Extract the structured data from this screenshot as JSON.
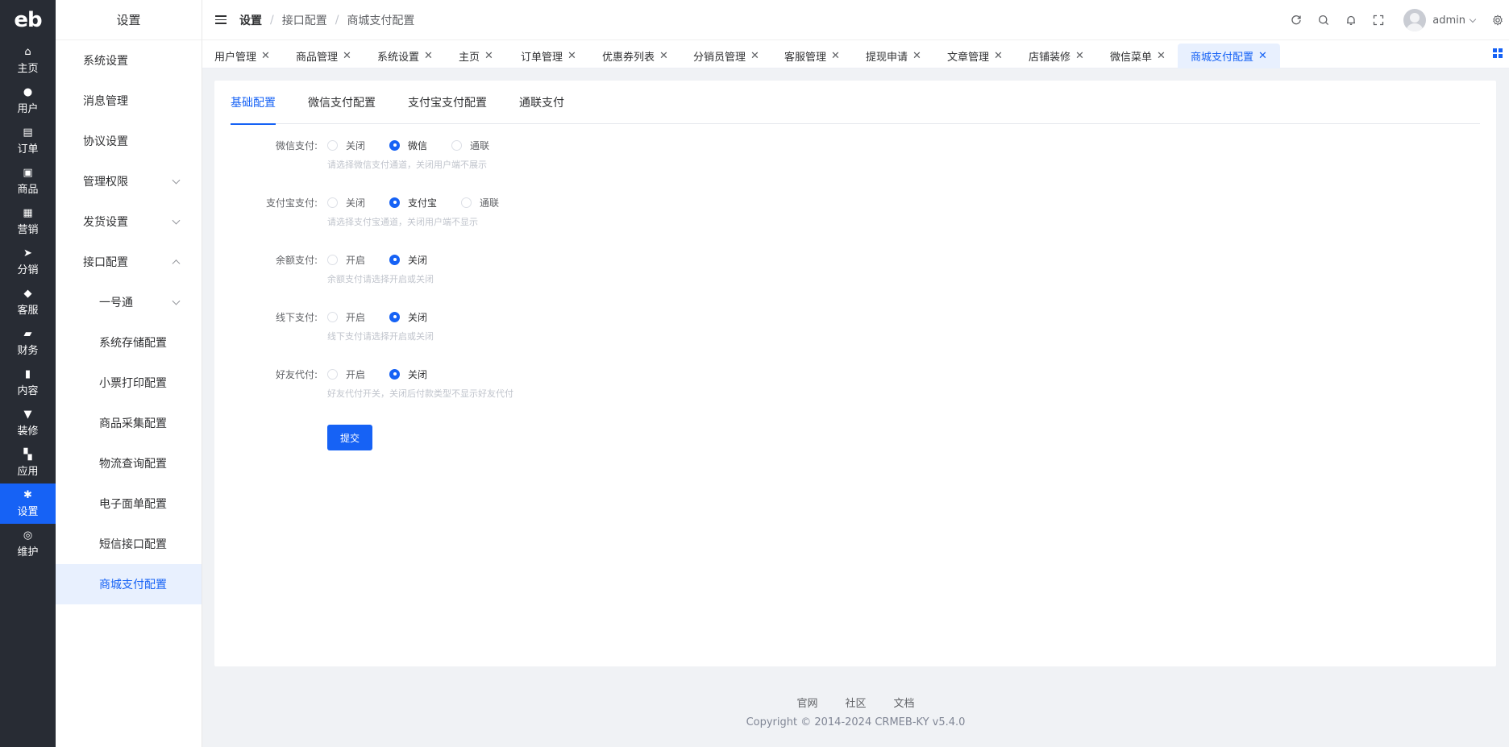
{
  "rail": {
    "logo": "eb",
    "items": [
      {
        "label": "主页",
        "icon": "home-icon",
        "glyph": "⌂"
      },
      {
        "label": "用户",
        "icon": "user-icon",
        "glyph": "●"
      },
      {
        "label": "订单",
        "icon": "order-icon",
        "glyph": "▤"
      },
      {
        "label": "商品",
        "icon": "product-icon",
        "glyph": "▣"
      },
      {
        "label": "营销",
        "icon": "marketing-icon",
        "glyph": "▦"
      },
      {
        "label": "分销",
        "icon": "distribution-icon",
        "glyph": "➤"
      },
      {
        "label": "客服",
        "icon": "service-icon",
        "glyph": "◆"
      },
      {
        "label": "财务",
        "icon": "finance-icon",
        "glyph": "▰"
      },
      {
        "label": "内容",
        "icon": "content-icon",
        "glyph": "▮"
      },
      {
        "label": "装修",
        "icon": "decoration-icon",
        "glyph": "▼"
      },
      {
        "label": "应用",
        "icon": "apps-icon",
        "glyph": "▚"
      },
      {
        "label": "设置",
        "icon": "settings-icon",
        "glyph": "✱"
      },
      {
        "label": "维护",
        "icon": "maintenance-icon",
        "glyph": "◎"
      }
    ]
  },
  "submenu": {
    "title": "设置",
    "items": [
      "系统设置",
      "消息管理",
      "协议设置",
      "管理权限",
      "发货设置",
      "接口配置",
      "一号通",
      "系统存储配置",
      "小票打印配置",
      "商品采集配置",
      "物流查询配置",
      "电子面单配置",
      "短信接口配置",
      "商城支付配置"
    ]
  },
  "header": {
    "breadcrumb": [
      "设置",
      "接口配置",
      "商城支付配置"
    ],
    "username": "admin"
  },
  "tags": [
    "用户管理",
    "商品管理",
    "系统设置",
    "主页",
    "订单管理",
    "优惠券列表",
    "分销员管理",
    "客服管理",
    "提现申请",
    "文章管理",
    "店铺装修",
    "微信菜单",
    "商城支付配置"
  ],
  "page_tabs": [
    "基础配置",
    "微信支付配置",
    "支付宝支付配置",
    "通联支付"
  ],
  "form": {
    "rows": [
      {
        "label": "微信支付:",
        "options": [
          "关闭",
          "微信",
          "通联"
        ],
        "selected": "微信",
        "hint": "请选择微信支付通道，关闭用户端不展示"
      },
      {
        "label": "支付宝支付:",
        "options": [
          "关闭",
          "支付宝",
          "通联"
        ],
        "selected": "支付宝",
        "hint": "请选择支付宝通道，关闭用户端不显示"
      },
      {
        "label": "余额支付:",
        "options": [
          "开启",
          "关闭"
        ],
        "selected": "关闭",
        "hint": "余额支付请选择开启或关闭"
      },
      {
        "label": "线下支付:",
        "options": [
          "开启",
          "关闭"
        ],
        "selected": "关闭",
        "hint": "线下支付请选择开启或关闭"
      },
      {
        "label": "好友代付:",
        "options": [
          "开启",
          "关闭"
        ],
        "selected": "关闭",
        "hint": "好友代付开关，关闭后付款类型不显示好友代付"
      }
    ],
    "submit_label": "提交"
  },
  "footer": {
    "links": [
      "官网",
      "社区",
      "文档"
    ],
    "copyright": "Copyright © 2014-2024 CRMEB-KY v5.4.0"
  },
  "colors": {
    "accent": "#1662f5",
    "rail_bg": "#282c34"
  }
}
